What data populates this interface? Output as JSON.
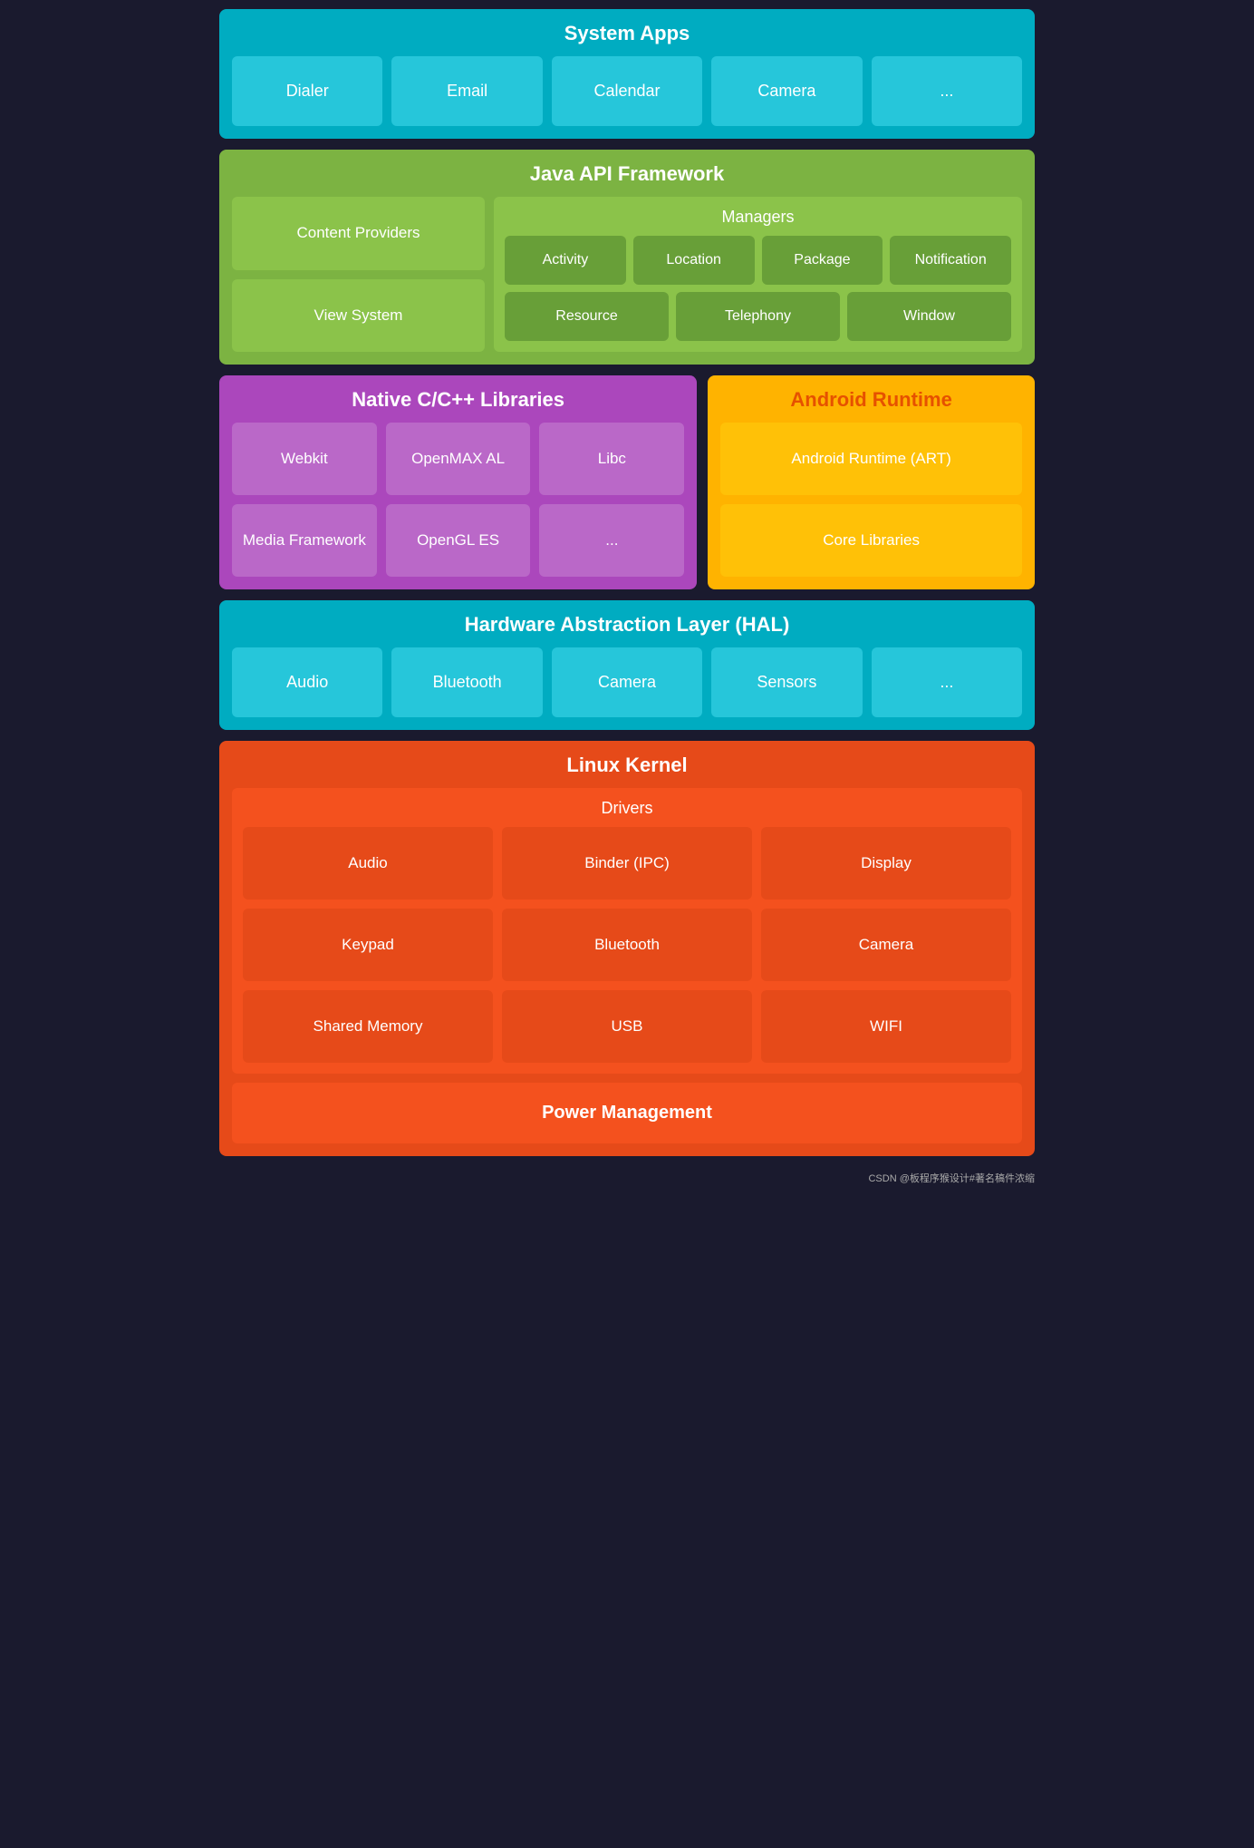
{
  "systemApps": {
    "title": "System Apps",
    "apps": [
      "Dialer",
      "Email",
      "Calendar",
      "Camera",
      "..."
    ]
  },
  "javaApiFramework": {
    "title": "Java API Framework",
    "left": {
      "items": [
        "Content Providers",
        "View System"
      ]
    },
    "right": {
      "groupTitle": "Managers",
      "row1": [
        "Activity",
        "Location",
        "Package",
        "Notification"
      ],
      "row2": [
        "Resource",
        "Telephony",
        "Window"
      ]
    }
  },
  "nativeCpp": {
    "title": "Native C/C++ Libraries",
    "items": [
      "Webkit",
      "OpenMAX AL",
      "Libc",
      "Media Framework",
      "OpenGL ES",
      "..."
    ]
  },
  "androidRuntime": {
    "title": "Android Runtime",
    "items": [
      "Android Runtime (ART)",
      "Core Libraries"
    ]
  },
  "hal": {
    "title": "Hardware Abstraction Layer (HAL)",
    "items": [
      "Audio",
      "Bluetooth",
      "Camera",
      "Sensors",
      "..."
    ]
  },
  "linuxKernel": {
    "title": "Linux Kernel",
    "drivers": {
      "title": "Drivers",
      "items": [
        "Audio",
        "Binder (IPC)",
        "Display",
        "Keypad",
        "Bluetooth",
        "Camera",
        "Shared Memory",
        "USB",
        "WIFI"
      ]
    },
    "powerManagement": "Power Management"
  },
  "watermark": "CSDN @板程序猴设计#著名稿件浓缩"
}
